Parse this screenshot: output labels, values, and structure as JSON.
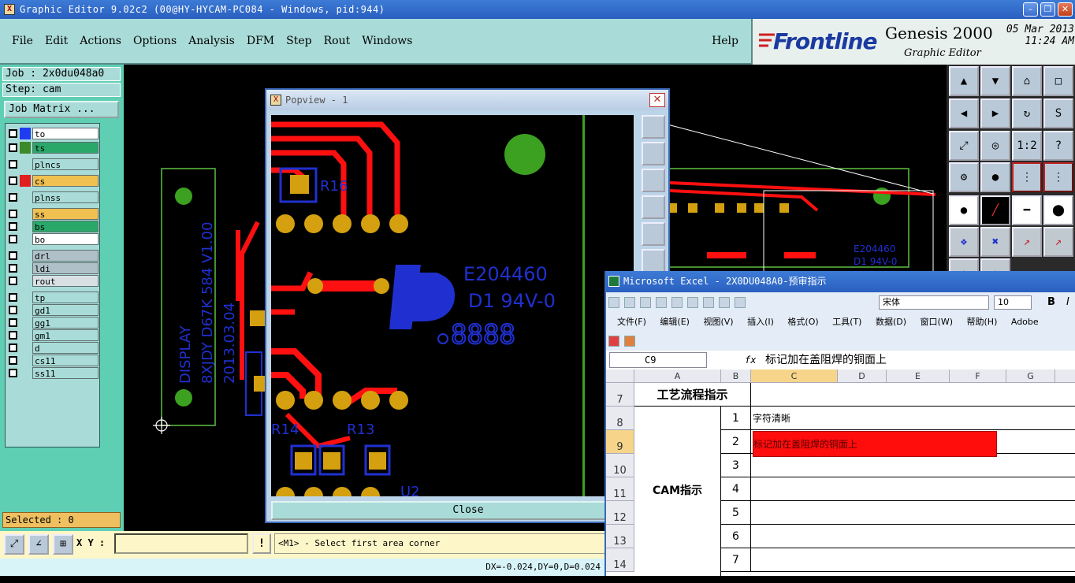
{
  "titlebar": {
    "title": "Graphic Editor 9.02c2 (00@HY-HYCAM-PC084 - Windows, pid:944)",
    "icon": "X"
  },
  "menu": [
    "File",
    "Edit",
    "Actions",
    "Options",
    "Analysis",
    "DFM",
    "Step",
    "Rout",
    "Windows"
  ],
  "help": "Help",
  "brand": {
    "logo": "Frontline",
    "product": "Genesis 2000",
    "subtitle": "Graphic Editor",
    "date": "05 Mar 2013",
    "time": "11:24 AM"
  },
  "left": {
    "job": "Job : 2x0du048a0",
    "step": "Step: cam",
    "job_matrix": "Job Matrix ...",
    "selected": "Selected : 0",
    "layers": [
      {
        "name": "to",
        "swatch": "#1f3cf0",
        "bg": "#ffffff"
      },
      {
        "name": "ts",
        "swatch": "#3c8a2a",
        "bg": "#2aa86a"
      },
      {
        "name": "plncs",
        "swatch": "",
        "bg": "#a9dcd8"
      },
      {
        "name": "cs",
        "swatch": "#e02020",
        "bg": "#f0c050"
      },
      {
        "name": "plnss",
        "swatch": "",
        "bg": "#a9dcd8"
      },
      {
        "name": "ss",
        "swatch": "",
        "bg": "#f0c050"
      },
      {
        "name": "bs",
        "swatch": "",
        "bg": "#2aa86a"
      },
      {
        "name": "bo",
        "swatch": "",
        "bg": "#ffffff"
      },
      {
        "name": "drl",
        "swatch": "",
        "bg": "#b0c0c8"
      },
      {
        "name": "ldi",
        "swatch": "",
        "bg": "#b0c0c8"
      },
      {
        "name": "rout",
        "swatch": "",
        "bg": "#d8e0e4"
      },
      {
        "name": "tp",
        "swatch": "",
        "bg": "#a9dcd8"
      },
      {
        "name": "gd1",
        "swatch": "",
        "bg": "#a9dcd8"
      },
      {
        "name": "gg1",
        "swatch": "",
        "bg": "#a9dcd8"
      },
      {
        "name": "gm1",
        "swatch": "",
        "bg": "#a9dcd8"
      },
      {
        "name": "d",
        "swatch": "",
        "bg": "#a9dcd8"
      },
      {
        "name": "cs11",
        "swatch": "",
        "bg": "#a9dcd8"
      },
      {
        "name": "ss11",
        "swatch": "",
        "bg": "#a9dcd8"
      }
    ]
  },
  "board_text": {
    "silk": [
      "DISPLAY",
      "8XJDY D67K 584 V1.00",
      "2013.03.04"
    ],
    "mark1": "E204460",
    "mark2": "D1 94V-0",
    "digits": "8888",
    "r16": "R16",
    "r14": "R14",
    "r13": "R13",
    "u2": "U2"
  },
  "popview": {
    "title": "Popview - 1",
    "close_label": "Close"
  },
  "bottom": {
    "xy_label": "X Y :",
    "xy_value": "",
    "prompt": "<M1> - Select first area corner",
    "status": "DX=-0.024,DY=0,D=0.024"
  },
  "excel": {
    "title": "Microsoft Excel - 2X0DU048A0-预审指示",
    "font": "宋体",
    "size": "10",
    "menu": [
      "文件(F)",
      "编辑(E)",
      "视图(V)",
      "插入(I)",
      "格式(O)",
      "工具(T)",
      "数据(D)",
      "窗口(W)",
      "帮助(H)",
      "Adobe"
    ],
    "namebox": "C9",
    "formula": "标记加在盖阻焊的铜面上",
    "columns": [
      "A",
      "B",
      "C",
      "D",
      "E",
      "F",
      "G"
    ],
    "rows": [
      "7",
      "8",
      "9",
      "10",
      "11",
      "12",
      "13",
      "14"
    ],
    "a7": "工艺流程指示",
    "a_cam": "CAM指示",
    "b_nums": [
      "1",
      "2",
      "3",
      "4",
      "5",
      "6",
      "7"
    ],
    "c8": "字符清晰",
    "c9": "标记加在盖阻焊的铜面上"
  }
}
